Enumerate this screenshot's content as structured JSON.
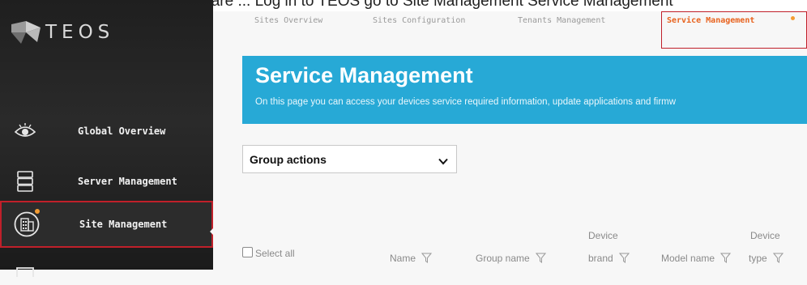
{
  "caption": "Step Update your device firmware ... Log in to TEOS go to Site Management Service Management",
  "brand": {
    "logo_text": "TEOS"
  },
  "sidebar": {
    "items": [
      {
        "label": "Global Overview",
        "icon": "eye-icon"
      },
      {
        "label": "Server Management",
        "icon": "server-icon"
      },
      {
        "label": "Site Management",
        "icon": "building-icon",
        "active": true,
        "notification": true
      },
      {
        "label": "",
        "icon": "monitor-icon"
      }
    ]
  },
  "tabs": [
    {
      "label": "Sites Overview"
    },
    {
      "label": "Sites Configuration"
    },
    {
      "label": "Tenants Management"
    },
    {
      "label": "Service Management",
      "active": true,
      "notification": true
    }
  ],
  "banner": {
    "title": "Service Management",
    "subtitle": "On this page you can access your devices service required information, update applications and firmw"
  },
  "group_actions": {
    "value": "Group actions"
  },
  "table": {
    "select_all": "Select all",
    "columns": [
      {
        "line1": "",
        "line2": "Name"
      },
      {
        "line1": "",
        "line2": "Group name"
      },
      {
        "line1": "Device",
        "line2": "brand"
      },
      {
        "line1": "",
        "line2": "Model name"
      },
      {
        "line1": "Device",
        "line2": "type"
      }
    ]
  },
  "colors": {
    "accent": "#27a9d6",
    "active_tab": "#e8621e",
    "highlight_border": "#c0202a",
    "badge": "#f39c33"
  }
}
